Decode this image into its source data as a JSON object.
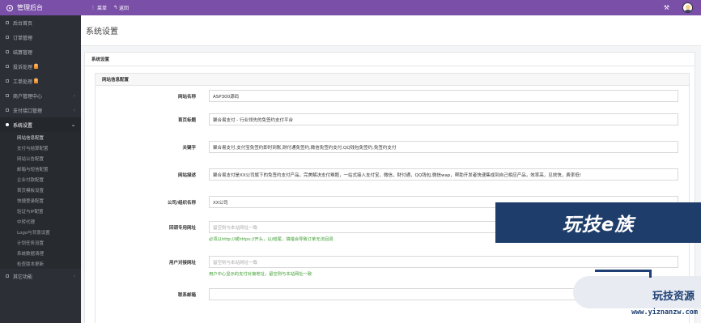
{
  "app": {
    "title": "管理后台"
  },
  "topnav": {
    "menu_label": "菜单",
    "back_label": "返回"
  },
  "sidebar": {
    "items": [
      {
        "label": "后台首页"
      },
      {
        "label": "订单管理"
      },
      {
        "label": "结算管理"
      },
      {
        "label": "投诉处理",
        "badge": "0"
      },
      {
        "label": "工单处理",
        "badge": "0"
      },
      {
        "label": "商户管理中心",
        "chevron": "‹"
      },
      {
        "label": "支付接口管理",
        "chevron": "‹"
      },
      {
        "label": "系统设置",
        "chevron": "⌄"
      }
    ],
    "sub_items": [
      "网站信息配置",
      "支付与结算配置",
      "网站公告配置",
      "邮箱与短信配置",
      "企业付款配置",
      "首页模板设置",
      "快捷登录配置",
      "验证与IP配置",
      "中转代理",
      "Logo与背景设置",
      "计划任务设置",
      "系统数据清理",
      "检查版本更新"
    ],
    "last_item": {
      "label": "其它功能",
      "chevron": "‹"
    }
  },
  "page": {
    "title": "系统设置"
  },
  "panel": {
    "title": "系统设置"
  },
  "inner": {
    "title": "网站信息配置"
  },
  "form": {
    "site_name": {
      "label": "网站名称",
      "value": "ASP300源码"
    },
    "home_title": {
      "label": "首页标题",
      "value": "聚合易支付 - 行业领先的免签约支付平台"
    },
    "keywords": {
      "label": "关键字",
      "value": "聚合易支付,支付宝免签约即时到账,财付通免签约,微信免签约支付,QQ钱包免签约,免签约支付"
    },
    "description": {
      "label": "网站描述",
      "value": "聚合易支付是XX公司旗下的免签约支付产品，完美解决支付难题，一站式接入支付宝，微信，财付通，QQ钱包,微信wap，帮助开发者快速集成到自己相应产品，效率高，见效快，费率低!"
    },
    "company": {
      "label": "公司/组织名称",
      "value": "XX公司"
    },
    "callback_url": {
      "label": "回调专用网址",
      "placeholder": "留空则与本站网址一致",
      "help": "必须以http://或https://开头，以/结尾，填错会导致订单无法回调"
    },
    "user_url": {
      "label": "用户对接网址",
      "placeholder": "留空则与本站网址一致",
      "help": "用户中心显示的支付对接地址，留空则与本站网址一致"
    },
    "email": {
      "label": "联系邮箱",
      "value": ""
    }
  },
  "watermarks": {
    "banner": "玩技e族",
    "logo_text": "玩技资源",
    "logo_url": "www.yiznanzw.com"
  },
  "colors": {
    "topbar": "#7a4fa8",
    "sidebar": "#2c2f35",
    "help_text": "#3a9c2e"
  }
}
